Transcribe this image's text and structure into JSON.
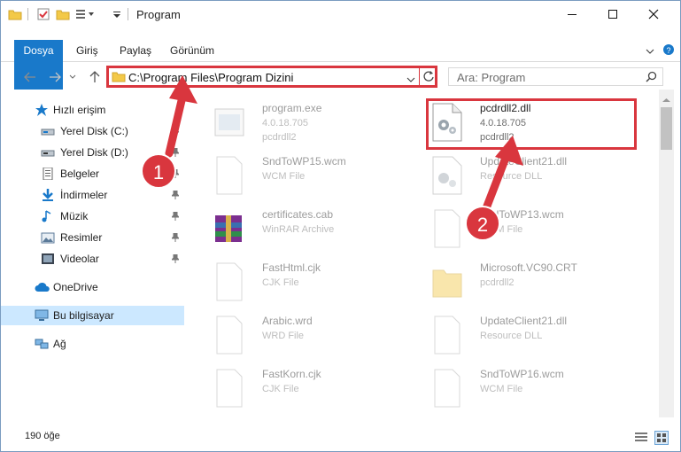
{
  "window": {
    "title": "Program"
  },
  "ribbon": {
    "tabs": [
      "Dosya",
      "Giriş",
      "Paylaş",
      "Görünüm"
    ]
  },
  "address": {
    "path": "C:\\Program Files\\Program Dizini"
  },
  "search": {
    "placeholder": "Ara: Program"
  },
  "sidebar": {
    "quick_access": "Hızlı erişim",
    "items": [
      {
        "label": "Yerel Disk (C:)",
        "icon": "drive-icon",
        "pinned": true
      },
      {
        "label": "Yerel Disk (D:)",
        "icon": "drive-icon",
        "pinned": true
      },
      {
        "label": "Belgeler",
        "icon": "documents-icon",
        "pinned": true
      },
      {
        "label": "İndirmeler",
        "icon": "download-icon",
        "pinned": true
      },
      {
        "label": "Müzik",
        "icon": "music-icon",
        "pinned": true
      },
      {
        "label": "Resimler",
        "icon": "pictures-icon",
        "pinned": true
      },
      {
        "label": "Videolar",
        "icon": "videos-icon",
        "pinned": true
      }
    ],
    "onedrive": "OneDrive",
    "this_pc": "Bu bilgisayar",
    "network": "Ağ"
  },
  "files": [
    {
      "name": "program.exe",
      "line2": "4.0.18.705",
      "line3": "pcdrdll2",
      "kind": "exe",
      "faded": true
    },
    {
      "name": "pcdrdll2.dll",
      "line2": "4.0.18.705",
      "line3": "pcdrdll2",
      "kind": "dll",
      "faded": false
    },
    {
      "name": "SndToWP15.wcm",
      "line2": "WCM File",
      "line3": "",
      "kind": "doc",
      "faded": true
    },
    {
      "name": "UpdateClient21.dll",
      "line2": "Resource DLL",
      "line3": "",
      "kind": "dll",
      "faded": true
    },
    {
      "name": "certificates.cab",
      "line2": "WinRAR Archive",
      "line3": "",
      "kind": "rar",
      "faded": true
    },
    {
      "name": "SndToWP13.wcm",
      "line2": "WCM File",
      "line3": "",
      "kind": "doc",
      "faded": true
    },
    {
      "name": "FastHtml.cjk",
      "line2": "CJK File",
      "line3": "",
      "kind": "doc",
      "faded": true
    },
    {
      "name": "Microsoft.VC90.CRT",
      "line2": "pcdrdll2",
      "line3": "",
      "kind": "folder",
      "faded": true
    },
    {
      "name": "Arabic.wrd",
      "line2": "WRD File",
      "line3": "",
      "kind": "doc",
      "faded": true
    },
    {
      "name": "UpdateClient21.dll",
      "line2": "Resource DLL",
      "line3": "",
      "kind": "doc",
      "faded": true
    },
    {
      "name": "FastKorn.cjk",
      "line2": "CJK File",
      "line3": "",
      "kind": "doc",
      "faded": true
    },
    {
      "name": "SndToWP16.wcm",
      "line2": "WCM File",
      "line3": "",
      "kind": "doc",
      "faded": true
    }
  ],
  "status": {
    "count": "190 öğe"
  },
  "annotations": {
    "marker1": "1",
    "marker2": "2"
  },
  "colors": {
    "accent": "#1979ca",
    "highlight": "#d9363e",
    "selected": "#cce8ff"
  }
}
